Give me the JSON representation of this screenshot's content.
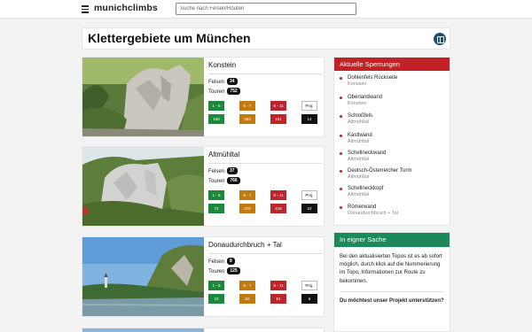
{
  "nav": {
    "logo": "munichclimbs",
    "search_placeholder": "Suche nach Felsen/Routen"
  },
  "page": {
    "title": "Klettergebiete um München"
  },
  "stat_labels": {
    "felsen": "Felsen",
    "touren": "Touren"
  },
  "grade_labels": [
    "1 - 5",
    "6 - 7",
    "8 - 11",
    "Proj."
  ],
  "areas": [
    {
      "name": "Konstein",
      "felsen": "34",
      "touren": "752",
      "counts": [
        "168",
        "383",
        "191",
        "14"
      ]
    },
    {
      "name": "Altmühltal",
      "felsen": "37",
      "touren": "766",
      "counts": [
        "72",
        "278",
        "418",
        "22"
      ]
    },
    {
      "name": "Donaudurchbruch + Tal",
      "felsen": "8",
      "touren": "125",
      "counts": [
        "10",
        "62",
        "51",
        "6"
      ]
    }
  ],
  "sperrungen": {
    "title": "Aktuelle Sperrungen",
    "items": [
      {
        "name": "Dohlenfels Rückseite",
        "area": "Konstein"
      },
      {
        "name": "Oberlandwand",
        "area": "Konstein"
      },
      {
        "name": "Schloßfels",
        "area": "Altmühltal"
      },
      {
        "name": "Kastlwand",
        "area": "Altmühltal"
      },
      {
        "name": "Schellneckwand",
        "area": "Altmühltal"
      },
      {
        "name": "Deutsch-Österreicher Turm",
        "area": "Altmühltal"
      },
      {
        "name": "Schellneckkopf",
        "area": "Altmühltal"
      },
      {
        "name": "Römerwand",
        "area": "Donaudurchbruch + Tal"
      }
    ]
  },
  "sache": {
    "title": "In eigner Sache",
    "text": "Bei den aktualisierten Topos ist es ab sofort möglich, durch klick auf die Nummerierung im Topo, Informationen zur Route zu bekommen.",
    "question": "Du möchtest unser Projekt unterstützen?"
  },
  "colors": {
    "green": "#1a8a3a",
    "orange": "#c07a10",
    "red": "#c32127",
    "black": "#111111",
    "sache_green": "#1a8a5a",
    "icon_blue": "#1f4d7a"
  }
}
